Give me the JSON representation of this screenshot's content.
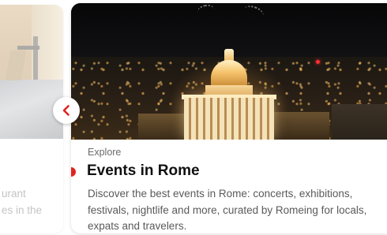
{
  "carousel": {
    "prev_card": {
      "text_line_1": "urant",
      "text_line_2": "es in the"
    },
    "current_card": {
      "eyebrow": "Explore",
      "title": "Events in Rome",
      "description": "Discover the best events in Rome: concerts, exhibitions, festivals, nightlife and more, curated by Romeing for locals, expats and travelers."
    },
    "nav": {
      "prev_icon": "chevron-left-icon"
    }
  },
  "colors": {
    "accent": "#e1231f",
    "title": "#111111",
    "body_text": "#5a5a5a"
  }
}
